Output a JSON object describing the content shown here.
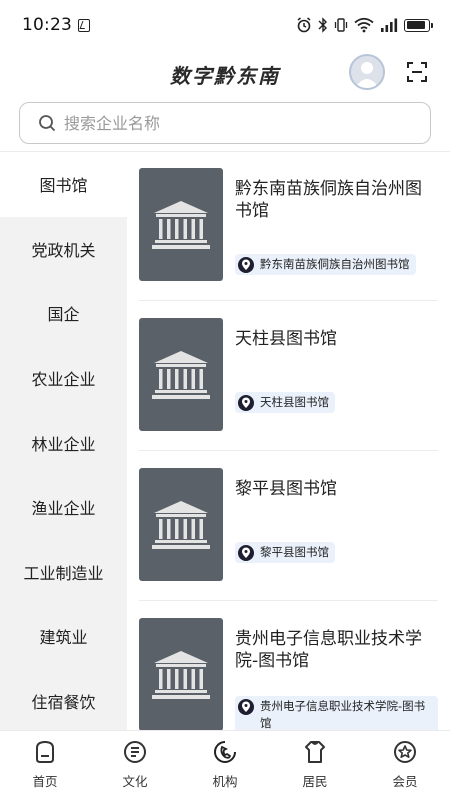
{
  "status_bar": {
    "time": "10:23",
    "battery_level": 0.9,
    "icons": [
      "nfc-icon",
      "alarm-icon",
      "bluetooth-icon",
      "vibrate-icon",
      "wifi-icon",
      "signal-icon",
      "battery-icon"
    ]
  },
  "header": {
    "title": "数字黔东南",
    "icons": [
      "avatar",
      "scan-icon"
    ]
  },
  "search": {
    "placeholder": "搜索企业名称"
  },
  "sidebar": {
    "items": [
      {
        "label": "图书馆",
        "active": true
      },
      {
        "label": "党政机关"
      },
      {
        "label": "国企"
      },
      {
        "label": "农业企业"
      },
      {
        "label": "林业企业"
      },
      {
        "label": "渔业企业"
      },
      {
        "label": "工业制造业"
      },
      {
        "label": "建筑业"
      },
      {
        "label": "住宿餐饮"
      }
    ]
  },
  "cards": [
    {
      "title": "黔东南苗族侗族自治州图书馆",
      "tag": "黔东南苗族侗族自治州图书馆",
      "thumb_icon": "library-building-icon"
    },
    {
      "title": "天柱县图书馆",
      "tag": "天柱县图书馆",
      "thumb_icon": "library-building-icon"
    },
    {
      "title": "黎平县图书馆",
      "tag": "黎平县图书馆",
      "thumb_icon": "library-building-icon"
    },
    {
      "title": "贵州电子信息职业技术学院-图书馆",
      "tag": "贵州电子信息职业技术学院-图书馆",
      "thumb_icon": "library-building-icon"
    }
  ],
  "tabbar": {
    "items": [
      {
        "label": "首页",
        "icon": "home-icon"
      },
      {
        "label": "文化",
        "icon": "culture-icon"
      },
      {
        "label": "机构",
        "icon": "institution-icon",
        "active": true
      },
      {
        "label": "居民",
        "icon": "resident-icon"
      },
      {
        "label": "会员",
        "icon": "member-icon"
      }
    ]
  },
  "colors": {
    "sidebar_bg": "#f2f2f2",
    "thumb_bg": "#5b6168",
    "tag_bg": "#eaf1fb",
    "pin": "#1e1e30"
  }
}
